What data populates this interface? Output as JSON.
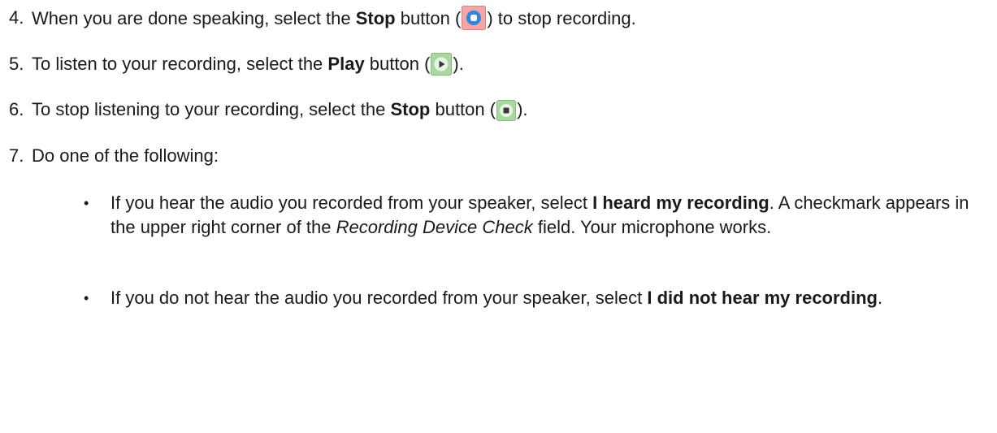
{
  "steps": [
    {
      "number": "4.",
      "before": "When you are done speaking, select the ",
      "bold": "Stop",
      "after_bold": " button (",
      "icon": "record-stop-icon",
      "end": ") to stop recording."
    },
    {
      "number": "5.",
      "before": "To listen to your recording, select the ",
      "bold": "Play",
      "after_bold": " button (",
      "icon": "play-icon",
      "end": ")."
    },
    {
      "number": "6.",
      "before": "To stop listening to your recording, select the ",
      "bold": "Stop",
      "after_bold": " button (",
      "icon": "playback-stop-icon",
      "end": ")."
    },
    {
      "number": "7.",
      "text": "Do one of the following:"
    }
  ],
  "bullets": [
    {
      "glyph": "•",
      "before": "If you hear the audio you recorded from your speaker, select ",
      "bold": "I heard my recording",
      "middle": ". A checkmark appears in the upper right corner of the ",
      "italic": "Recording Device Check",
      "end": " field. Your microphone works."
    },
    {
      "glyph": "•",
      "before": "If you do not hear the audio you recorded from your speaker, select ",
      "bold": "I did not hear my recording",
      "end": "."
    }
  ],
  "colors": {
    "record_stop_bg": "#f4a6a6",
    "record_stop_ring": "#2e86de",
    "play_bg": "#a8d8a0",
    "playback_stop_bg": "#a8d8a0",
    "glyph_dark": "#3a3a3a"
  }
}
